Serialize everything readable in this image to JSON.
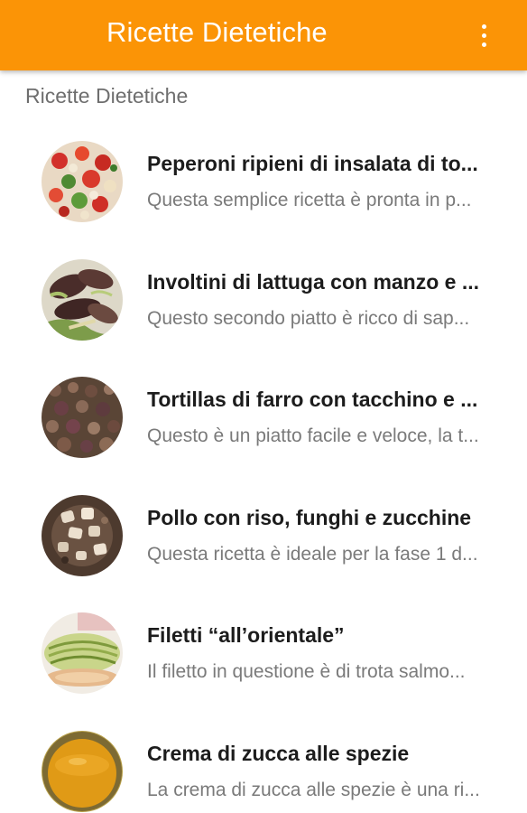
{
  "appbar": {
    "title": "Ricette Dietetiche",
    "background_color": "#fb9406",
    "overflow_icon": "more-vert-icon"
  },
  "section": {
    "header": "Ricette Dietetiche"
  },
  "recipes": [
    {
      "title": "Peperoni ripieni di insalata di to...",
      "description": "Questa semplice ricetta è pronta in p...",
      "image": "stuffed-peppers-salad-photo"
    },
    {
      "title": "Involtini di lattuga con manzo e ...",
      "description": "Questo secondo piatto è ricco di sap...",
      "image": "lettuce-beef-rolls-photo"
    },
    {
      "title": "Tortillas di farro con tacchino e ...",
      "description": "Questo è un piatto facile e veloce, la t...",
      "image": "spelt-tortillas-turkey-photo"
    },
    {
      "title": "Pollo con riso, funghi e zucchine",
      "description": "Questa ricetta è ideale per la fase 1 d...",
      "image": "chicken-rice-mushroom-photo"
    },
    {
      "title": "Filetti “all’orientale”",
      "description": "Il filetto in questione è di trota salmo...",
      "image": "oriental-fillets-photo"
    },
    {
      "title": "Crema di zucca alle spezie",
      "description": "La crema di zucca alle spezie è una ri...",
      "image": "spiced-pumpkin-cream-photo"
    }
  ]
}
